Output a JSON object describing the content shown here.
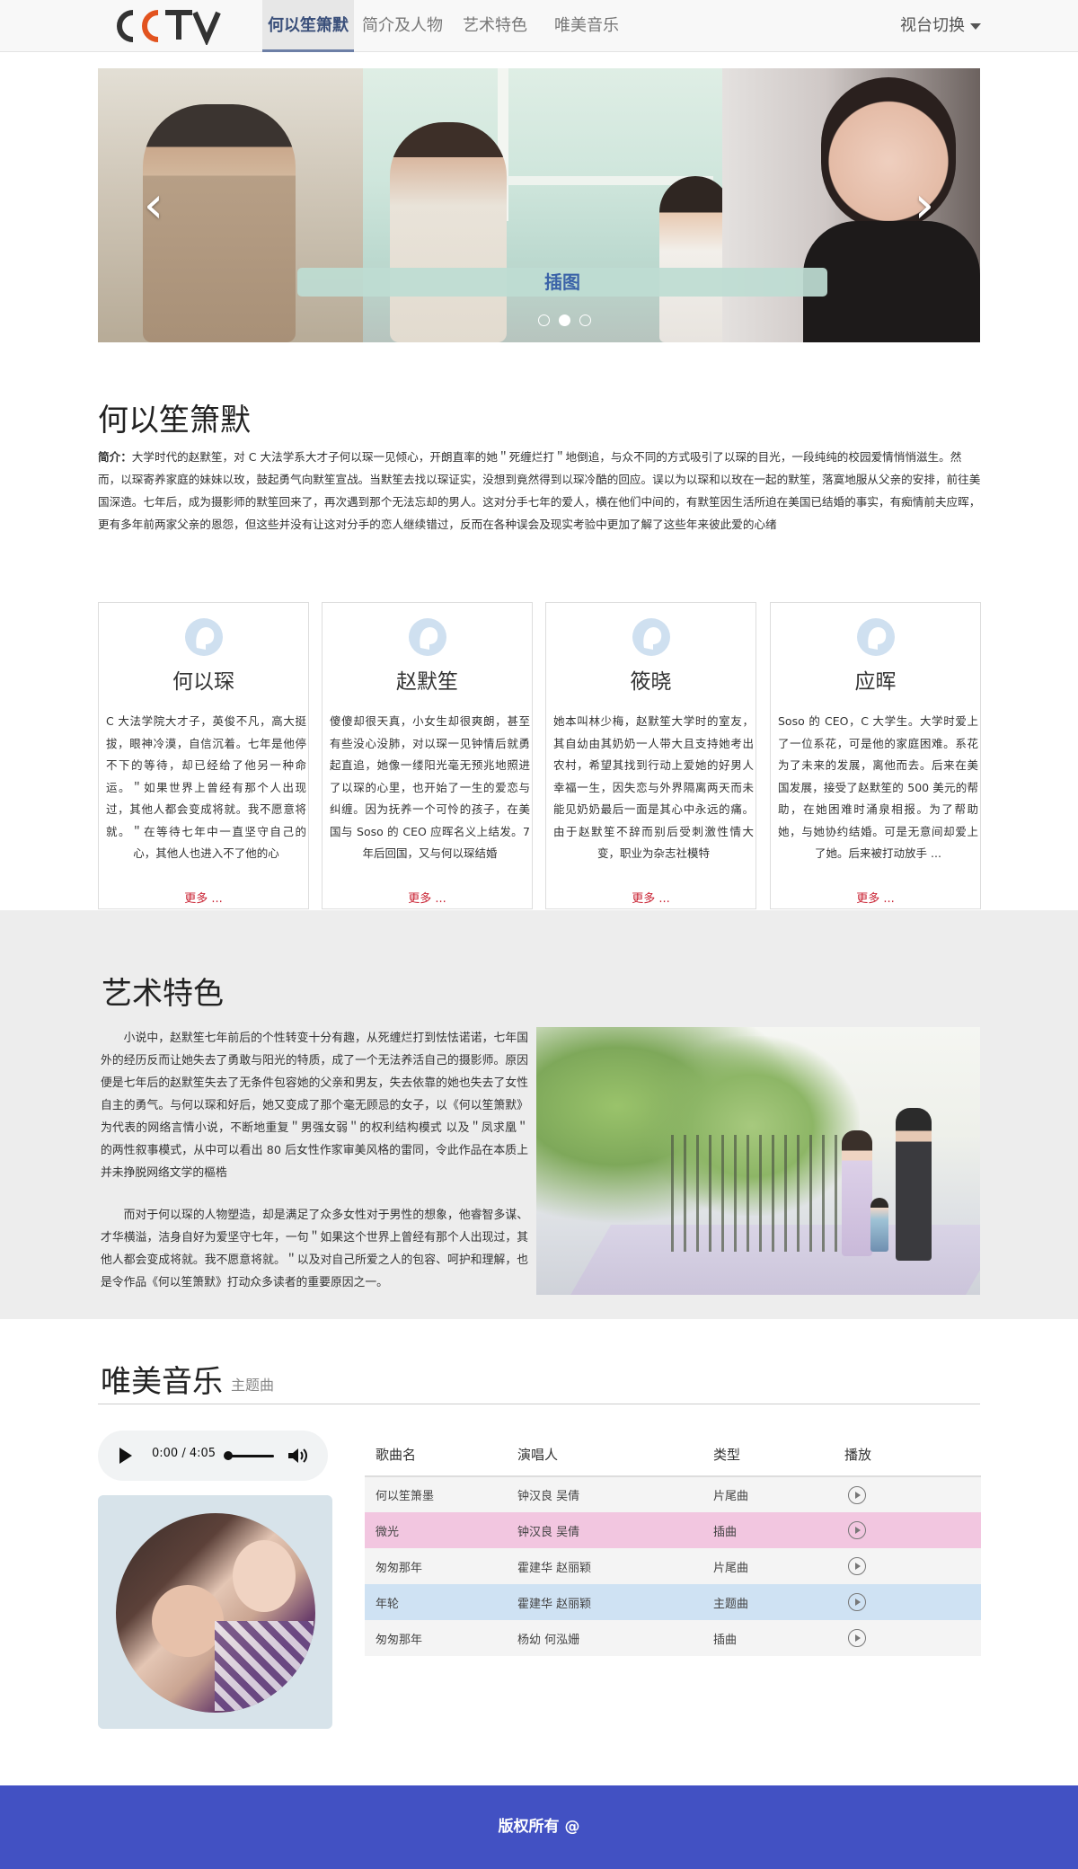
{
  "nav": {
    "logo_text": "CCTV",
    "items": [
      "何以笙箫默",
      "简介及人物",
      "艺术特色",
      "唯美音乐"
    ],
    "switch_label": "视台切换"
  },
  "carousel": {
    "caption": "插图",
    "prev_icon": "chevron-left-icon",
    "next_icon": "chevron-right-icon",
    "slide_count": 3,
    "active_index": 1
  },
  "intro": {
    "title": "何以笙箫默",
    "label": "简介：",
    "text": "大学时代的赵默笙，对 C 大法学系大才子何以琛一见倾心，开朗直率的她＂死缠烂打＂地倒追，与众不同的方式吸引了以琛的目光，一段纯纯的校园爱情悄悄滋生。然而，以琛寄养家庭的妹妹以玫，鼓起勇气向默笙宣战。当默笙去找以琛证实，没想到竟然得到以琛冷酷的回应。误以为以琛和以玫在一起的默笙，落寞地服从父亲的安排，前往美国深造。七年后，成为摄影师的默笙回来了，再次遇到那个无法忘却的男人。这对分手七年的爱人，横在他们中间的，有默笙因生活所迫在美国已结婚的事实，有痴情前夫应晖，更有多年前两家父亲的恩怨，但这些并没有让这对分手的恋人继续错过，反而在各种误会及现实考验中更加了解了这些年来彼此爱的心绪"
  },
  "characters": [
    {
      "name": "何以琛",
      "desc": "C 大法学院大才子，英俊不凡，高大挺拔，眼神冷漠，自信沉着。七年是他停不下的等待，却已经给了他另一种命运。＂如果世界上曾经有那个人出现过，其他人都会变成将就。我不愿意将就。＂在等待七年中一直坚守自己的心，其他人也进入不了他的心",
      "more": "更多 ..."
    },
    {
      "name": "赵默笙",
      "desc": "傻傻却很天真，小女生却很爽朗，甚至有些没心没肺，对以琛一见钟情后就勇起直追，她像一缕阳光毫无预兆地照进了以琛的心里，也开始了一生的爱恋与纠缠。因为抚养一个可怜的孩子，在美国与 Soso 的 CEO 应晖名义上结发。7 年后回国，又与何以琛结婚",
      "more": "更多 ..."
    },
    {
      "name": "筱晓",
      "desc": "她本叫林少梅，赵默笙大学时的室友，其自幼由其奶奶一人带大且支持她考出农村，希望其找到行动上爱她的好男人幸福一生，因失恋与外界隔离两天而未能见奶奶最后一面是其心中永远的痛。由于赵默笙不辞而别后受刺激性情大变，职业为杂志社模特",
      "more": "更多 ..."
    },
    {
      "name": "应晖",
      "desc": "Soso 的 CEO，C 大学生。大学时爱上了一位系花，可是他的家庭困难。系花为了未来的发展，离他而去。后来在美国发展，接受了赵默笙的 500 美元的帮助，在她困难时涌泉相报。为了帮助她，与她协约结婚。可是无意间却爱上了她。后来被打动放手 ...",
      "more": "更多 ..."
    }
  ],
  "art": {
    "title": "艺术特色",
    "p1": "小说中，赵默笙七年前后的个性转变十分有趣，从死缠烂打到怯怯诺诺，七年国外的经历反而让她失去了勇敢与阳光的特质，成了一个无法养活自己的摄影师。原因便是七年后的赵默笙失去了无条件包容她的父亲和男友，失去依靠的她也失去了女性自主的勇气。与何以琛和好后，她又变成了那个毫无顾忌的女子，以《何以笙箫默》为代表的网络言情小说，不断地重复＂男强女弱＂的权利结构模式 以及＂凤求凰＂的两性叙事模式，从中可以看出 80 后女性作家审美风格的雷同，令此作品在本质上并未挣脱网络文学的樞梏",
    "p2": "而对于何以琛的人物塑造，却是满足了众多女性对于男性的想象，他睿智多谋、才华横溢，洁身自好为爱坚守七年，一句＂如果这个世界上曾经有那个人出现过，其他人都会变成将就。我不愿意将就。＂以及对自己所爱之人的包容、呵护和理解，也是令作品《何以笙箫默》打动众多读者的重要原因之一。"
  },
  "music": {
    "title": "唯美音乐",
    "subtitle": "主题曲",
    "player": {
      "time": "0:00 / 4:05",
      "play_icon": "play-icon",
      "volume_icon": "volume-icon"
    },
    "columns": [
      "歌曲名",
      "演唱人",
      "类型",
      "播放"
    ],
    "songs": [
      {
        "name": "何以笙箫墨",
        "singer": "钟汉良  吴倩",
        "type": "片尾曲"
      },
      {
        "name": "微光",
        "singer": "钟汉良  吴倩",
        "type": "插曲"
      },
      {
        "name": "匆匆那年",
        "singer": "霍建华 赵丽颖",
        "type": "片尾曲"
      },
      {
        "name": "年轮",
        "singer": "霍建华 赵丽颖",
        "type": "主题曲"
      },
      {
        "name": "匆匆那年",
        "singer": "杨幼 何泓姗",
        "type": "插曲"
      }
    ],
    "row_colors": {
      "pink": "#f2c6e0",
      "blue": "#cfe2f3"
    }
  },
  "footer": {
    "text": "版权所有 @"
  },
  "colors": {
    "footer_bg": "#4251c3",
    "accent_red": "#c81e2f",
    "nav_active": "#3a4f7a"
  }
}
